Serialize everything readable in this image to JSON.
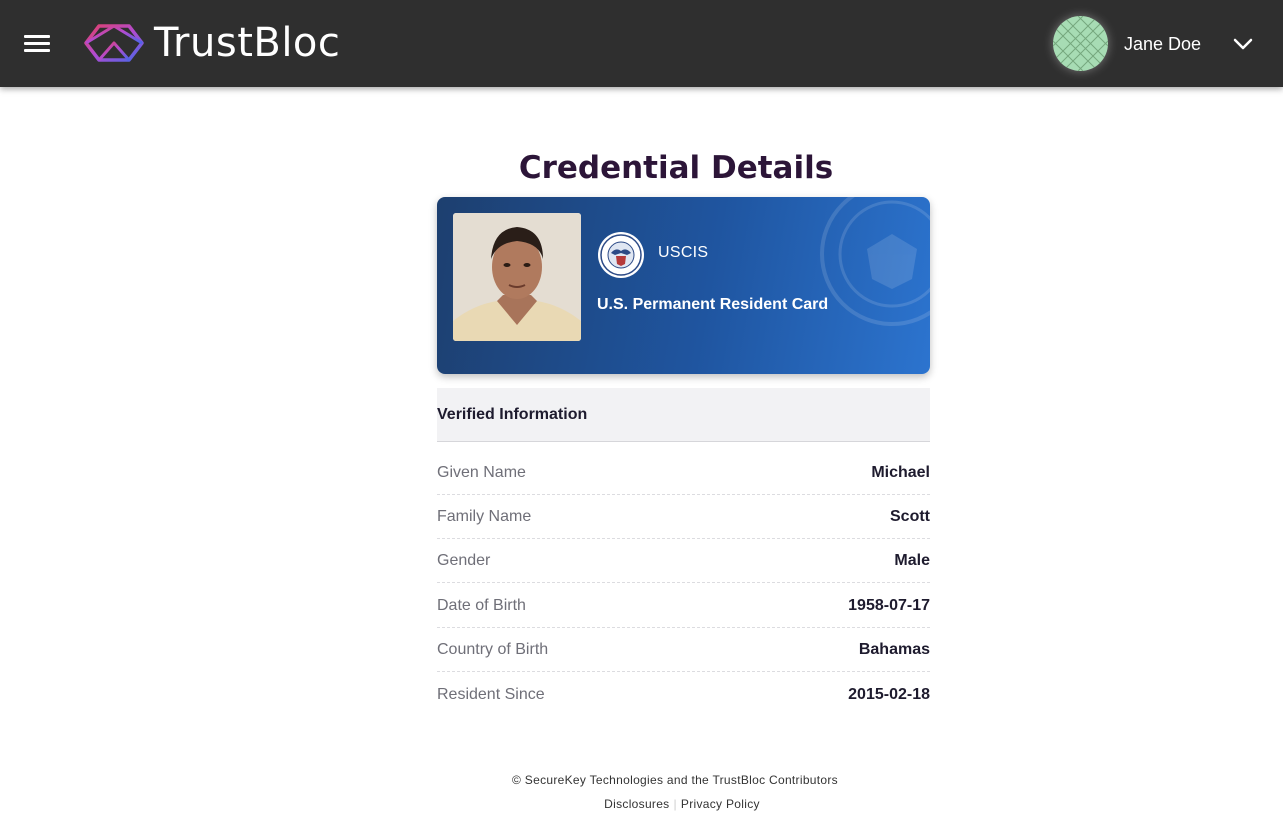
{
  "header": {
    "brand": "TrustBloc",
    "user_name": "Jane Doe",
    "icons": {
      "menu": "hamburger-menu-icon",
      "user_menu": "chevron-down-icon"
    },
    "colors": {
      "header_bg": "#2f2f2f",
      "avatar_bg": "#a7dcb4"
    }
  },
  "main": {
    "title": "Credential Details",
    "card": {
      "issuer": "USCIS",
      "credential_type": "U.S. Permanent Resident Card",
      "colors": {
        "gradient_start": "#1d3f6f",
        "gradient_end": "#2c74cf"
      }
    },
    "verified_section": {
      "heading": "Verified Information",
      "fields": [
        {
          "label": "Given Name",
          "value": "Michael"
        },
        {
          "label": "Family Name",
          "value": "Scott"
        },
        {
          "label": "Gender",
          "value": "Male"
        },
        {
          "label": "Date of Birth",
          "value": "1958-07-17"
        },
        {
          "label": "Country of Birth",
          "value": "Bahamas"
        },
        {
          "label": "Resident Since",
          "value": "2015-02-18"
        }
      ]
    }
  },
  "footer": {
    "copyright": "© SecureKey Technologies and the TrustBloc Contributors",
    "links": [
      "Disclosures",
      "Privacy Policy"
    ],
    "separator": "|"
  }
}
